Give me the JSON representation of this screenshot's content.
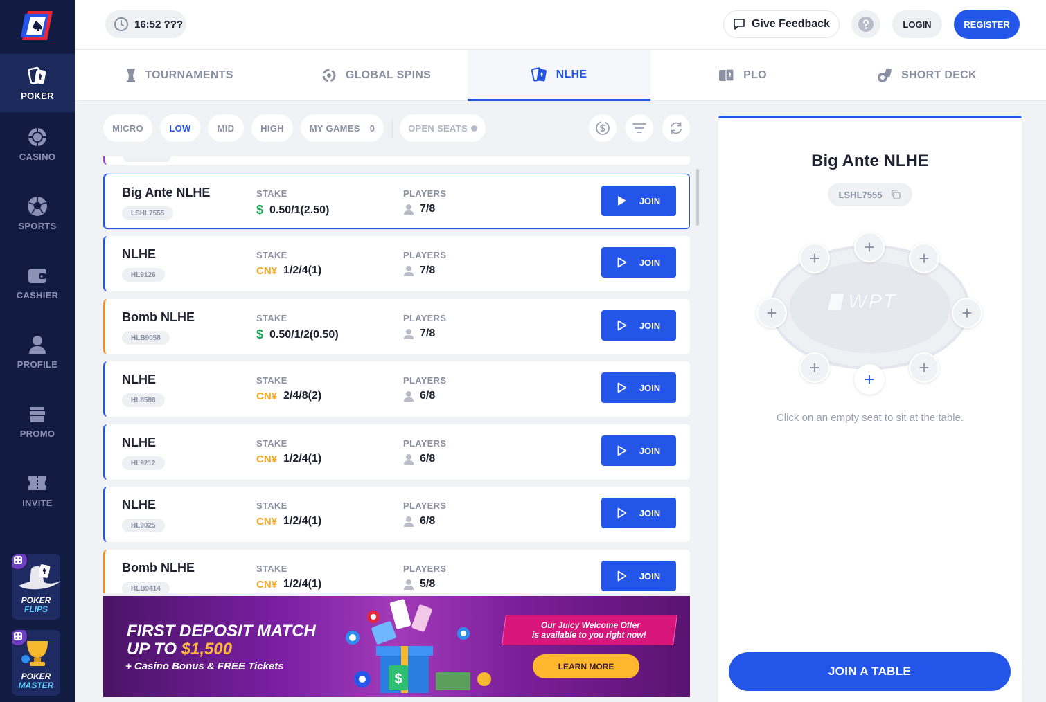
{
  "sidebar": {
    "items": [
      {
        "label": "POKER",
        "icon": "poker-icon"
      },
      {
        "label": "CASINO",
        "icon": "casino-icon"
      },
      {
        "label": "SPORTS",
        "icon": "sports-icon"
      },
      {
        "label": "CASHIER",
        "icon": "wallet-icon"
      },
      {
        "label": "PROFILE",
        "icon": "profile-icon"
      },
      {
        "label": "PROMO",
        "icon": "gift-icon"
      },
      {
        "label": "INVITE",
        "icon": "ticket-icon"
      }
    ],
    "tiles": [
      {
        "line1": "POKER",
        "line2": "FLIPS"
      },
      {
        "line1": "POKER",
        "line2": "MASTER"
      }
    ]
  },
  "header": {
    "clock": "16:52 ???",
    "feedback": "Give Feedback",
    "login": "LOGIN",
    "register": "REGISTER"
  },
  "tabs": [
    {
      "label": "TOURNAMENTS",
      "icon": "trophy-icon"
    },
    {
      "label": "GLOBAL SPINS",
      "icon": "spin-icon"
    },
    {
      "label": "NLHE",
      "icon": "cards-icon"
    },
    {
      "label": "PLO",
      "icon": "plo-cards-icon"
    },
    {
      "label": "SHORT DECK",
      "icon": "short-deck-icon"
    }
  ],
  "filters": {
    "chips": [
      "MICRO",
      "LOW",
      "MID",
      "HIGH"
    ],
    "active": "LOW",
    "my_games": "MY GAMES",
    "my_games_count": "0",
    "open_seats": "OPEN SEATS"
  },
  "list": {
    "stake_label": "STAKE",
    "players_label": "PLAYERS",
    "join_label": "JOIN",
    "rows": [
      {
        "name": "Big Ante NLHE",
        "code": "LSHL7555",
        "currency": "$",
        "stake": "0.50/1(2.50)",
        "players": "7/8"
      },
      {
        "name": "NLHE",
        "code": "HL9126",
        "currency": "CN¥",
        "stake": "1/2/4(1)",
        "players": "7/8"
      },
      {
        "name": "Bomb NLHE",
        "code": "HLB9058",
        "currency": "$",
        "stake": "0.50/1/2(0.50)",
        "players": "7/8"
      },
      {
        "name": "NLHE",
        "code": "HL8586",
        "currency": "CN¥",
        "stake": "2/4/8(2)",
        "players": "6/8"
      },
      {
        "name": "NLHE",
        "code": "HL9212",
        "currency": "CN¥",
        "stake": "1/2/4(1)",
        "players": "6/8"
      },
      {
        "name": "NLHE",
        "code": "HL9025",
        "currency": "CN¥",
        "stake": "1/2/4(1)",
        "players": "6/8"
      },
      {
        "name": "Bomb NLHE",
        "code": "HLB9414",
        "currency": "CN¥",
        "stake": "1/2/4(1)",
        "players": "5/8"
      }
    ]
  },
  "banner": {
    "line1": "FIRST DEPOSIT MATCH",
    "line2_prefix": "UP TO ",
    "line2_amount": "$1,500",
    "subtitle": "+ Casino Bonus & FREE Tickets",
    "offer_line1": "Our Juicy Welcome Offer",
    "offer_line2": "is available to you right now!",
    "button": "LEARN MORE"
  },
  "panel": {
    "title": "Big Ante NLHE",
    "code": "LSHL7555",
    "table_logo": "WPT",
    "hint": "Click on an empty seat to sit at the table.",
    "join_table": "JOIN A TABLE"
  },
  "colors": {
    "sidebar_bg": "#121c43",
    "accent": "#2356e8",
    "usd": "#1aa357",
    "cny": "#f5a623",
    "bomb_border": "#f08b2a"
  }
}
